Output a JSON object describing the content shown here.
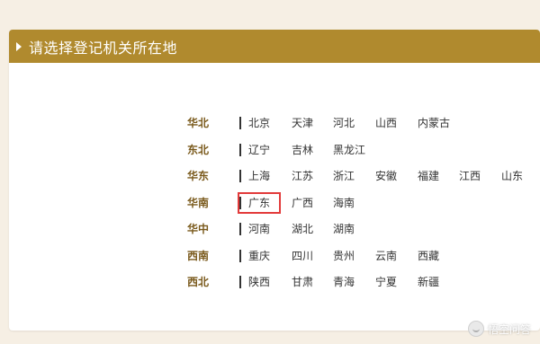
{
  "header": {
    "title": "请选择登记机关所在地",
    "background_color": "#b08a2e"
  },
  "regions": [
    {
      "label": "华北",
      "provinces": [
        "北京",
        "天津",
        "河北",
        "山西",
        "内蒙古"
      ]
    },
    {
      "label": "东北",
      "provinces": [
        "辽宁",
        "吉林",
        "黑龙江"
      ]
    },
    {
      "label": "华东",
      "provinces": [
        "上海",
        "江苏",
        "浙江",
        "安徽",
        "福建",
        "江西",
        "山东"
      ]
    },
    {
      "label": "华南",
      "provinces": [
        "广东",
        "广西",
        "海南"
      ],
      "selected": "广东"
    },
    {
      "label": "华中",
      "provinces": [
        "河南",
        "湖北",
        "湖南"
      ]
    },
    {
      "label": "西南",
      "provinces": [
        "重庆",
        "四川",
        "贵州",
        "云南",
        "西藏"
      ]
    },
    {
      "label": "西北",
      "provinces": [
        "陕西",
        "甘肃",
        "青海",
        "宁夏",
        "新疆"
      ]
    }
  ],
  "selection_color": "#e23a3a",
  "watermark": {
    "text": "悟空问答"
  }
}
